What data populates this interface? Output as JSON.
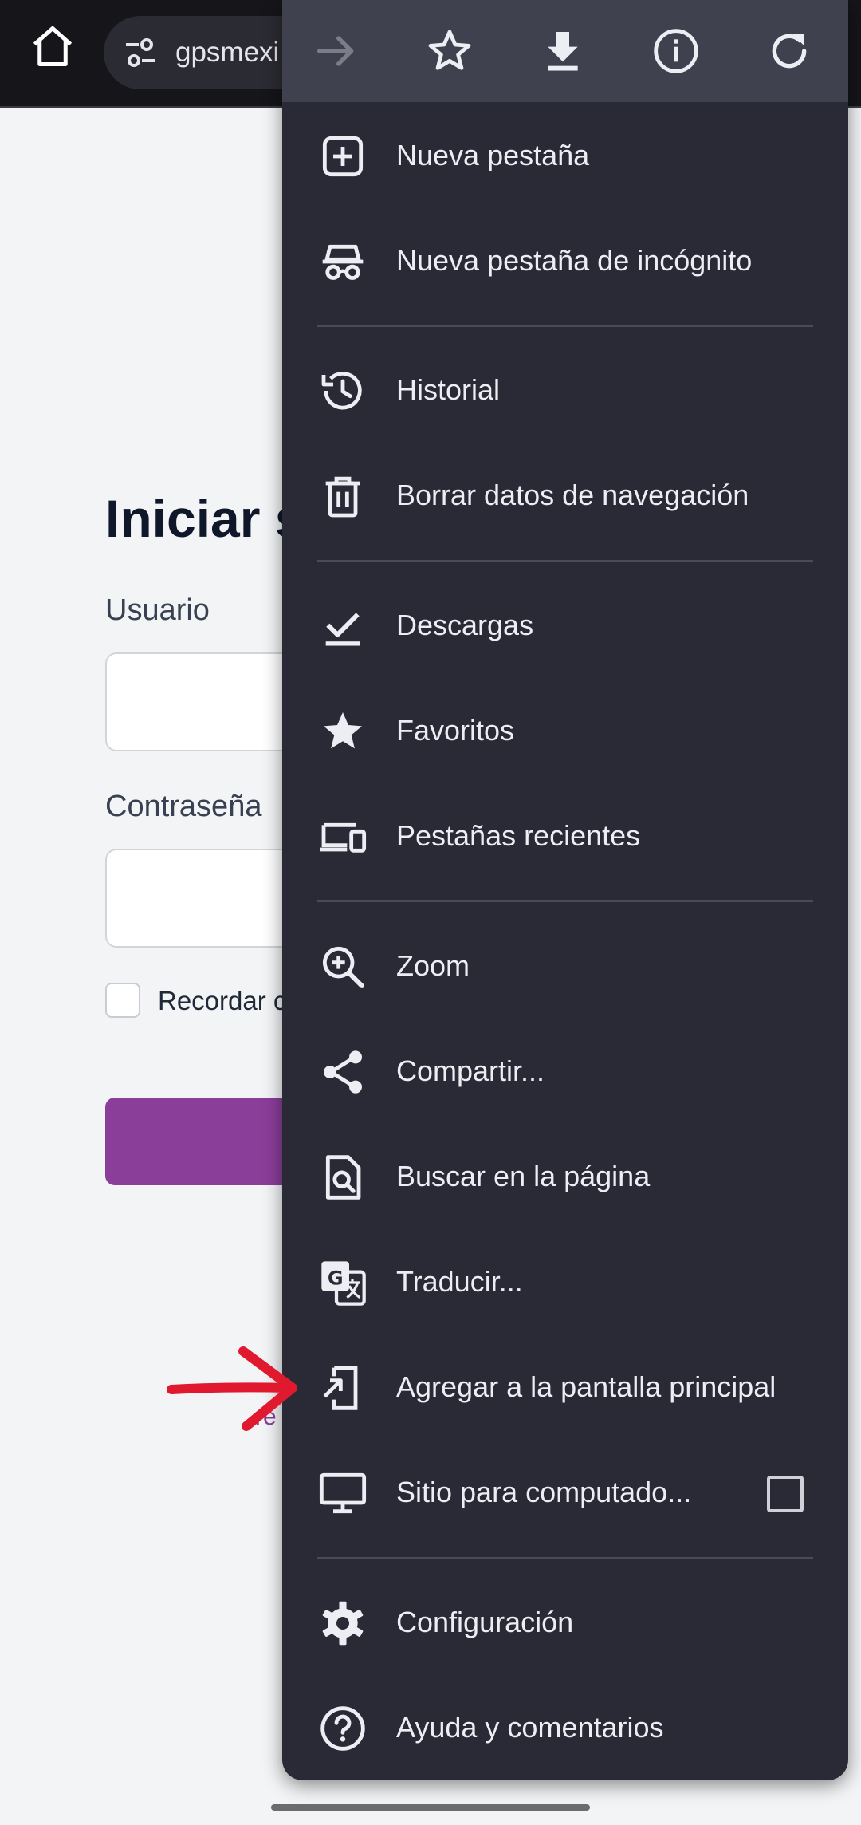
{
  "browser": {
    "url": "gpsmexi",
    "icons": {
      "home": "home-icon",
      "site_settings": "tune-icon"
    }
  },
  "page": {
    "title": "Iniciar s",
    "username_label": "Usuario",
    "password_label": "Contraseña",
    "remember_label": "Recordar c",
    "link_fragment": "re"
  },
  "menu": {
    "top_icons": [
      "forward-icon",
      "star-outline-icon",
      "download-icon",
      "info-icon",
      "refresh-icon"
    ],
    "items": [
      {
        "label": "Nueva pestaña",
        "icon": "new-tab-icon"
      },
      {
        "label": "Nueva pestaña de incógnito",
        "icon": "incognito-icon"
      },
      {
        "label": "Historial",
        "icon": "history-icon"
      },
      {
        "label": "Borrar datos de navegación",
        "icon": "trash-icon"
      },
      {
        "label": "Descargas",
        "icon": "downloads-check-icon"
      },
      {
        "label": "Favoritos",
        "icon": "star-filled-icon"
      },
      {
        "label": "Pestañas recientes",
        "icon": "devices-icon"
      },
      {
        "label": "Zoom",
        "icon": "zoom-in-icon"
      },
      {
        "label": "Compartir...",
        "icon": "share-icon"
      },
      {
        "label": "Buscar en la página",
        "icon": "find-in-page-icon"
      },
      {
        "label": "Traducir...",
        "icon": "translate-icon"
      },
      {
        "label": "Agregar a la pantalla principal",
        "icon": "add-to-home-icon"
      },
      {
        "label": "Sitio para computado...",
        "icon": "desktop-icon",
        "checked": false
      },
      {
        "label": "Configuración",
        "icon": "settings-gear-icon"
      },
      {
        "label": "Ayuda y comentarios",
        "icon": "help-icon"
      }
    ]
  },
  "colors": {
    "menu_bg": "#2a2a37",
    "menu_top_bg": "#40414f",
    "accent_purple": "#8b3d9a",
    "annotation_red": "#e0192f"
  }
}
